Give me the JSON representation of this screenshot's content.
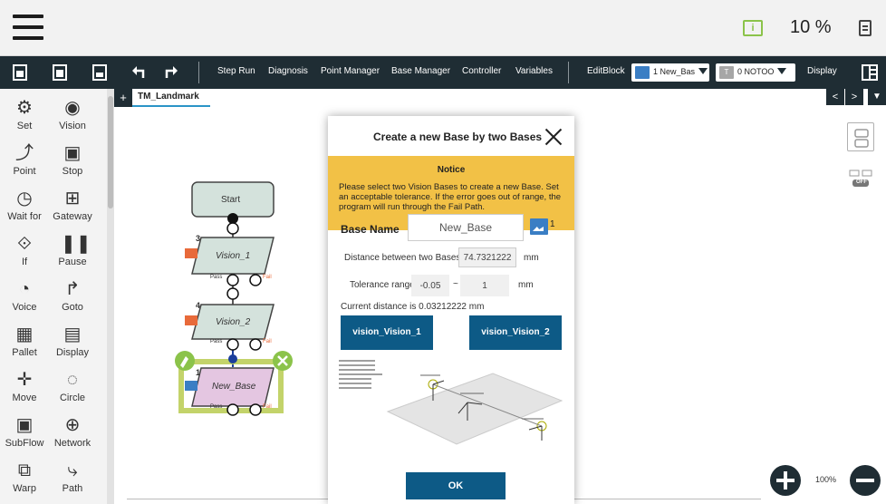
{
  "status": {
    "speed": "10 %",
    "battery_icon": "battery-icon",
    "note_icon": "note-icon"
  },
  "toolbar": {
    "step_run": "Step Run",
    "diagnosis": "Diagnosis",
    "point_manager": "Point Manager",
    "base_manager": "Base Manager",
    "controller": "Controller",
    "variables": "Variables",
    "editblock": "EditBlock",
    "base_select": "1 New_Bas",
    "tool_select": "0 NOTOO",
    "tool_badge": "T",
    "display": "Display"
  },
  "nodes": [
    {
      "label": "Set",
      "icon": "set-icon"
    },
    {
      "label": "Vision",
      "icon": "vision-icon"
    },
    {
      "label": "Point",
      "icon": "point-icon"
    },
    {
      "label": "Stop",
      "icon": "stop-icon"
    },
    {
      "label": "Wait for",
      "icon": "wait-icon"
    },
    {
      "label": "Gateway",
      "icon": "gateway-icon"
    },
    {
      "label": "If",
      "icon": "if-icon"
    },
    {
      "label": "Pause",
      "icon": "pause-icon"
    },
    {
      "label": "Voice",
      "icon": "voice-icon"
    },
    {
      "label": "Goto",
      "icon": "goto-icon"
    },
    {
      "label": "Pallet",
      "icon": "pallet-icon"
    },
    {
      "label": "Display",
      "icon": "display-icon"
    },
    {
      "label": "Move",
      "icon": "move-icon"
    },
    {
      "label": "Circle",
      "icon": "circle-icon"
    },
    {
      "label": "SubFlow",
      "icon": "subflow-icon"
    },
    {
      "label": "Network",
      "icon": "network-icon"
    },
    {
      "label": "Warp",
      "icon": "warp-icon"
    },
    {
      "label": "Path",
      "icon": "path-icon"
    }
  ],
  "tab": {
    "add": "+",
    "name": "TM_Landmark",
    "prev": "<",
    "next": ">"
  },
  "flow": {
    "start": "Start",
    "vision1": "Vision_1",
    "vision1_num": "3",
    "vision2": "Vision_2",
    "vision2_num": "4",
    "newbase": "New_Base",
    "newbase_num": "1",
    "pass": "Pass",
    "fail": "Fail"
  },
  "right_icons": {
    "toggle": "OFF"
  },
  "zoom": {
    "level": "100%"
  },
  "modal": {
    "title": "Create a new Base by two Bases",
    "notice_title": "Notice",
    "notice_body": "Please select two Vision Bases to create a new Base. Set an acceptable tolerance. If the error goes out of range, the program will run through the Fail Path.",
    "base_name_label": "Base Name",
    "base_name_value": "New_Base",
    "base_num": "1",
    "distance_label": "Distance between two Bases",
    "distance_value": "74.7321222",
    "distance_unit": "mm",
    "tolerance_label": "Tolerance range",
    "tolerance_min": "-0.05",
    "tolerance_sep": "~",
    "tolerance_max": "1",
    "tolerance_unit": "mm",
    "current_distance": "Current distance is 0.03212222 mm",
    "vision1_button": "vision_Vision_1",
    "vision2_button": "vision_Vision_2",
    "ok": "OK"
  }
}
